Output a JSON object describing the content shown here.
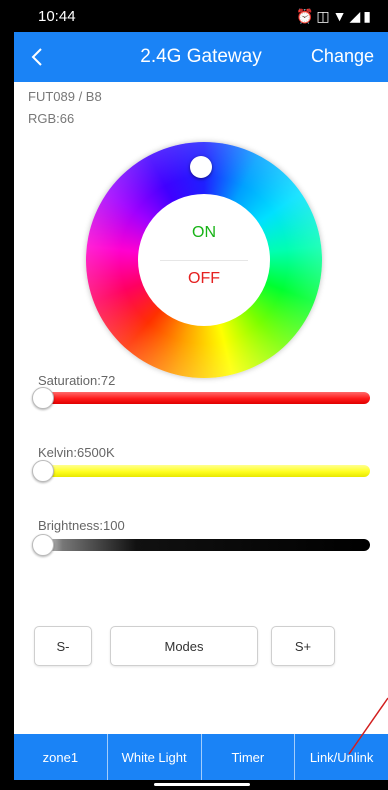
{
  "status_bar": {
    "time": "10:44",
    "icons": [
      "alarm-icon",
      "vibrate-icon",
      "wifi-icon",
      "signal-icon",
      "battery-icon"
    ]
  },
  "header": {
    "title": "2.4G Gateway",
    "action_label": "Change",
    "color": "#1a83f6"
  },
  "device": {
    "model": "FUT089 / B8",
    "rgb": "RGB:66"
  },
  "power": {
    "on_label": "ON",
    "off_label": "OFF",
    "on_color": "#17b316",
    "off_color": "#e52020"
  },
  "sliders": [
    {
      "label": "Saturation:72",
      "value": 72,
      "track_color": "#ff2a2a"
    },
    {
      "label": "Kelvin:6500K",
      "value": 6500,
      "track_color": "#ffff30"
    },
    {
      "label": "Brightness:100",
      "value": 100,
      "track_color": "#111111"
    }
  ],
  "buttons": {
    "s_minus": "S-",
    "modes": "Modes",
    "s_plus": "S+"
  },
  "tabs": [
    "zone1",
    "White Light",
    "Timer",
    "Link/Unlink"
  ]
}
